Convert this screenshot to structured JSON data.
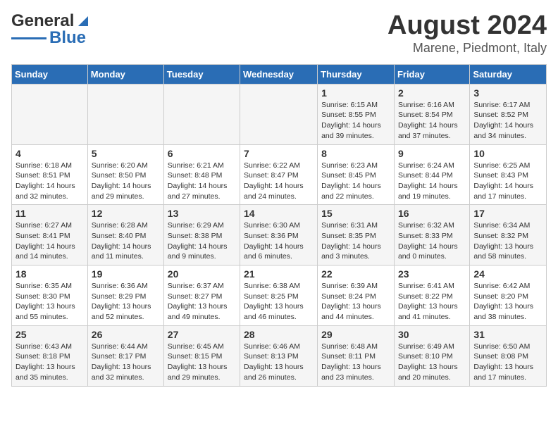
{
  "logo": {
    "line1": "General",
    "line2": "Blue"
  },
  "title": "August 2024",
  "subtitle": "Marene, Piedmont, Italy",
  "headers": [
    "Sunday",
    "Monday",
    "Tuesday",
    "Wednesday",
    "Thursday",
    "Friday",
    "Saturday"
  ],
  "weeks": [
    [
      {
        "day": "",
        "info": ""
      },
      {
        "day": "",
        "info": ""
      },
      {
        "day": "",
        "info": ""
      },
      {
        "day": "",
        "info": ""
      },
      {
        "day": "1",
        "info": "Sunrise: 6:15 AM\nSunset: 8:55 PM\nDaylight: 14 hours and 39 minutes."
      },
      {
        "day": "2",
        "info": "Sunrise: 6:16 AM\nSunset: 8:54 PM\nDaylight: 14 hours and 37 minutes."
      },
      {
        "day": "3",
        "info": "Sunrise: 6:17 AM\nSunset: 8:52 PM\nDaylight: 14 hours and 34 minutes."
      }
    ],
    [
      {
        "day": "4",
        "info": "Sunrise: 6:18 AM\nSunset: 8:51 PM\nDaylight: 14 hours and 32 minutes."
      },
      {
        "day": "5",
        "info": "Sunrise: 6:20 AM\nSunset: 8:50 PM\nDaylight: 14 hours and 29 minutes."
      },
      {
        "day": "6",
        "info": "Sunrise: 6:21 AM\nSunset: 8:48 PM\nDaylight: 14 hours and 27 minutes."
      },
      {
        "day": "7",
        "info": "Sunrise: 6:22 AM\nSunset: 8:47 PM\nDaylight: 14 hours and 24 minutes."
      },
      {
        "day": "8",
        "info": "Sunrise: 6:23 AM\nSunset: 8:45 PM\nDaylight: 14 hours and 22 minutes."
      },
      {
        "day": "9",
        "info": "Sunrise: 6:24 AM\nSunset: 8:44 PM\nDaylight: 14 hours and 19 minutes."
      },
      {
        "day": "10",
        "info": "Sunrise: 6:25 AM\nSunset: 8:43 PM\nDaylight: 14 hours and 17 minutes."
      }
    ],
    [
      {
        "day": "11",
        "info": "Sunrise: 6:27 AM\nSunset: 8:41 PM\nDaylight: 14 hours and 14 minutes."
      },
      {
        "day": "12",
        "info": "Sunrise: 6:28 AM\nSunset: 8:40 PM\nDaylight: 14 hours and 11 minutes."
      },
      {
        "day": "13",
        "info": "Sunrise: 6:29 AM\nSunset: 8:38 PM\nDaylight: 14 hours and 9 minutes."
      },
      {
        "day": "14",
        "info": "Sunrise: 6:30 AM\nSunset: 8:36 PM\nDaylight: 14 hours and 6 minutes."
      },
      {
        "day": "15",
        "info": "Sunrise: 6:31 AM\nSunset: 8:35 PM\nDaylight: 14 hours and 3 minutes."
      },
      {
        "day": "16",
        "info": "Sunrise: 6:32 AM\nSunset: 8:33 PM\nDaylight: 14 hours and 0 minutes."
      },
      {
        "day": "17",
        "info": "Sunrise: 6:34 AM\nSunset: 8:32 PM\nDaylight: 13 hours and 58 minutes."
      }
    ],
    [
      {
        "day": "18",
        "info": "Sunrise: 6:35 AM\nSunset: 8:30 PM\nDaylight: 13 hours and 55 minutes."
      },
      {
        "day": "19",
        "info": "Sunrise: 6:36 AM\nSunset: 8:29 PM\nDaylight: 13 hours and 52 minutes."
      },
      {
        "day": "20",
        "info": "Sunrise: 6:37 AM\nSunset: 8:27 PM\nDaylight: 13 hours and 49 minutes."
      },
      {
        "day": "21",
        "info": "Sunrise: 6:38 AM\nSunset: 8:25 PM\nDaylight: 13 hours and 46 minutes."
      },
      {
        "day": "22",
        "info": "Sunrise: 6:39 AM\nSunset: 8:24 PM\nDaylight: 13 hours and 44 minutes."
      },
      {
        "day": "23",
        "info": "Sunrise: 6:41 AM\nSunset: 8:22 PM\nDaylight: 13 hours and 41 minutes."
      },
      {
        "day": "24",
        "info": "Sunrise: 6:42 AM\nSunset: 8:20 PM\nDaylight: 13 hours and 38 minutes."
      }
    ],
    [
      {
        "day": "25",
        "info": "Sunrise: 6:43 AM\nSunset: 8:18 PM\nDaylight: 13 hours and 35 minutes."
      },
      {
        "day": "26",
        "info": "Sunrise: 6:44 AM\nSunset: 8:17 PM\nDaylight: 13 hours and 32 minutes."
      },
      {
        "day": "27",
        "info": "Sunrise: 6:45 AM\nSunset: 8:15 PM\nDaylight: 13 hours and 29 minutes."
      },
      {
        "day": "28",
        "info": "Sunrise: 6:46 AM\nSunset: 8:13 PM\nDaylight: 13 hours and 26 minutes."
      },
      {
        "day": "29",
        "info": "Sunrise: 6:48 AM\nSunset: 8:11 PM\nDaylight: 13 hours and 23 minutes."
      },
      {
        "day": "30",
        "info": "Sunrise: 6:49 AM\nSunset: 8:10 PM\nDaylight: 13 hours and 20 minutes."
      },
      {
        "day": "31",
        "info": "Sunrise: 6:50 AM\nSunset: 8:08 PM\nDaylight: 13 hours and 17 minutes."
      }
    ]
  ]
}
